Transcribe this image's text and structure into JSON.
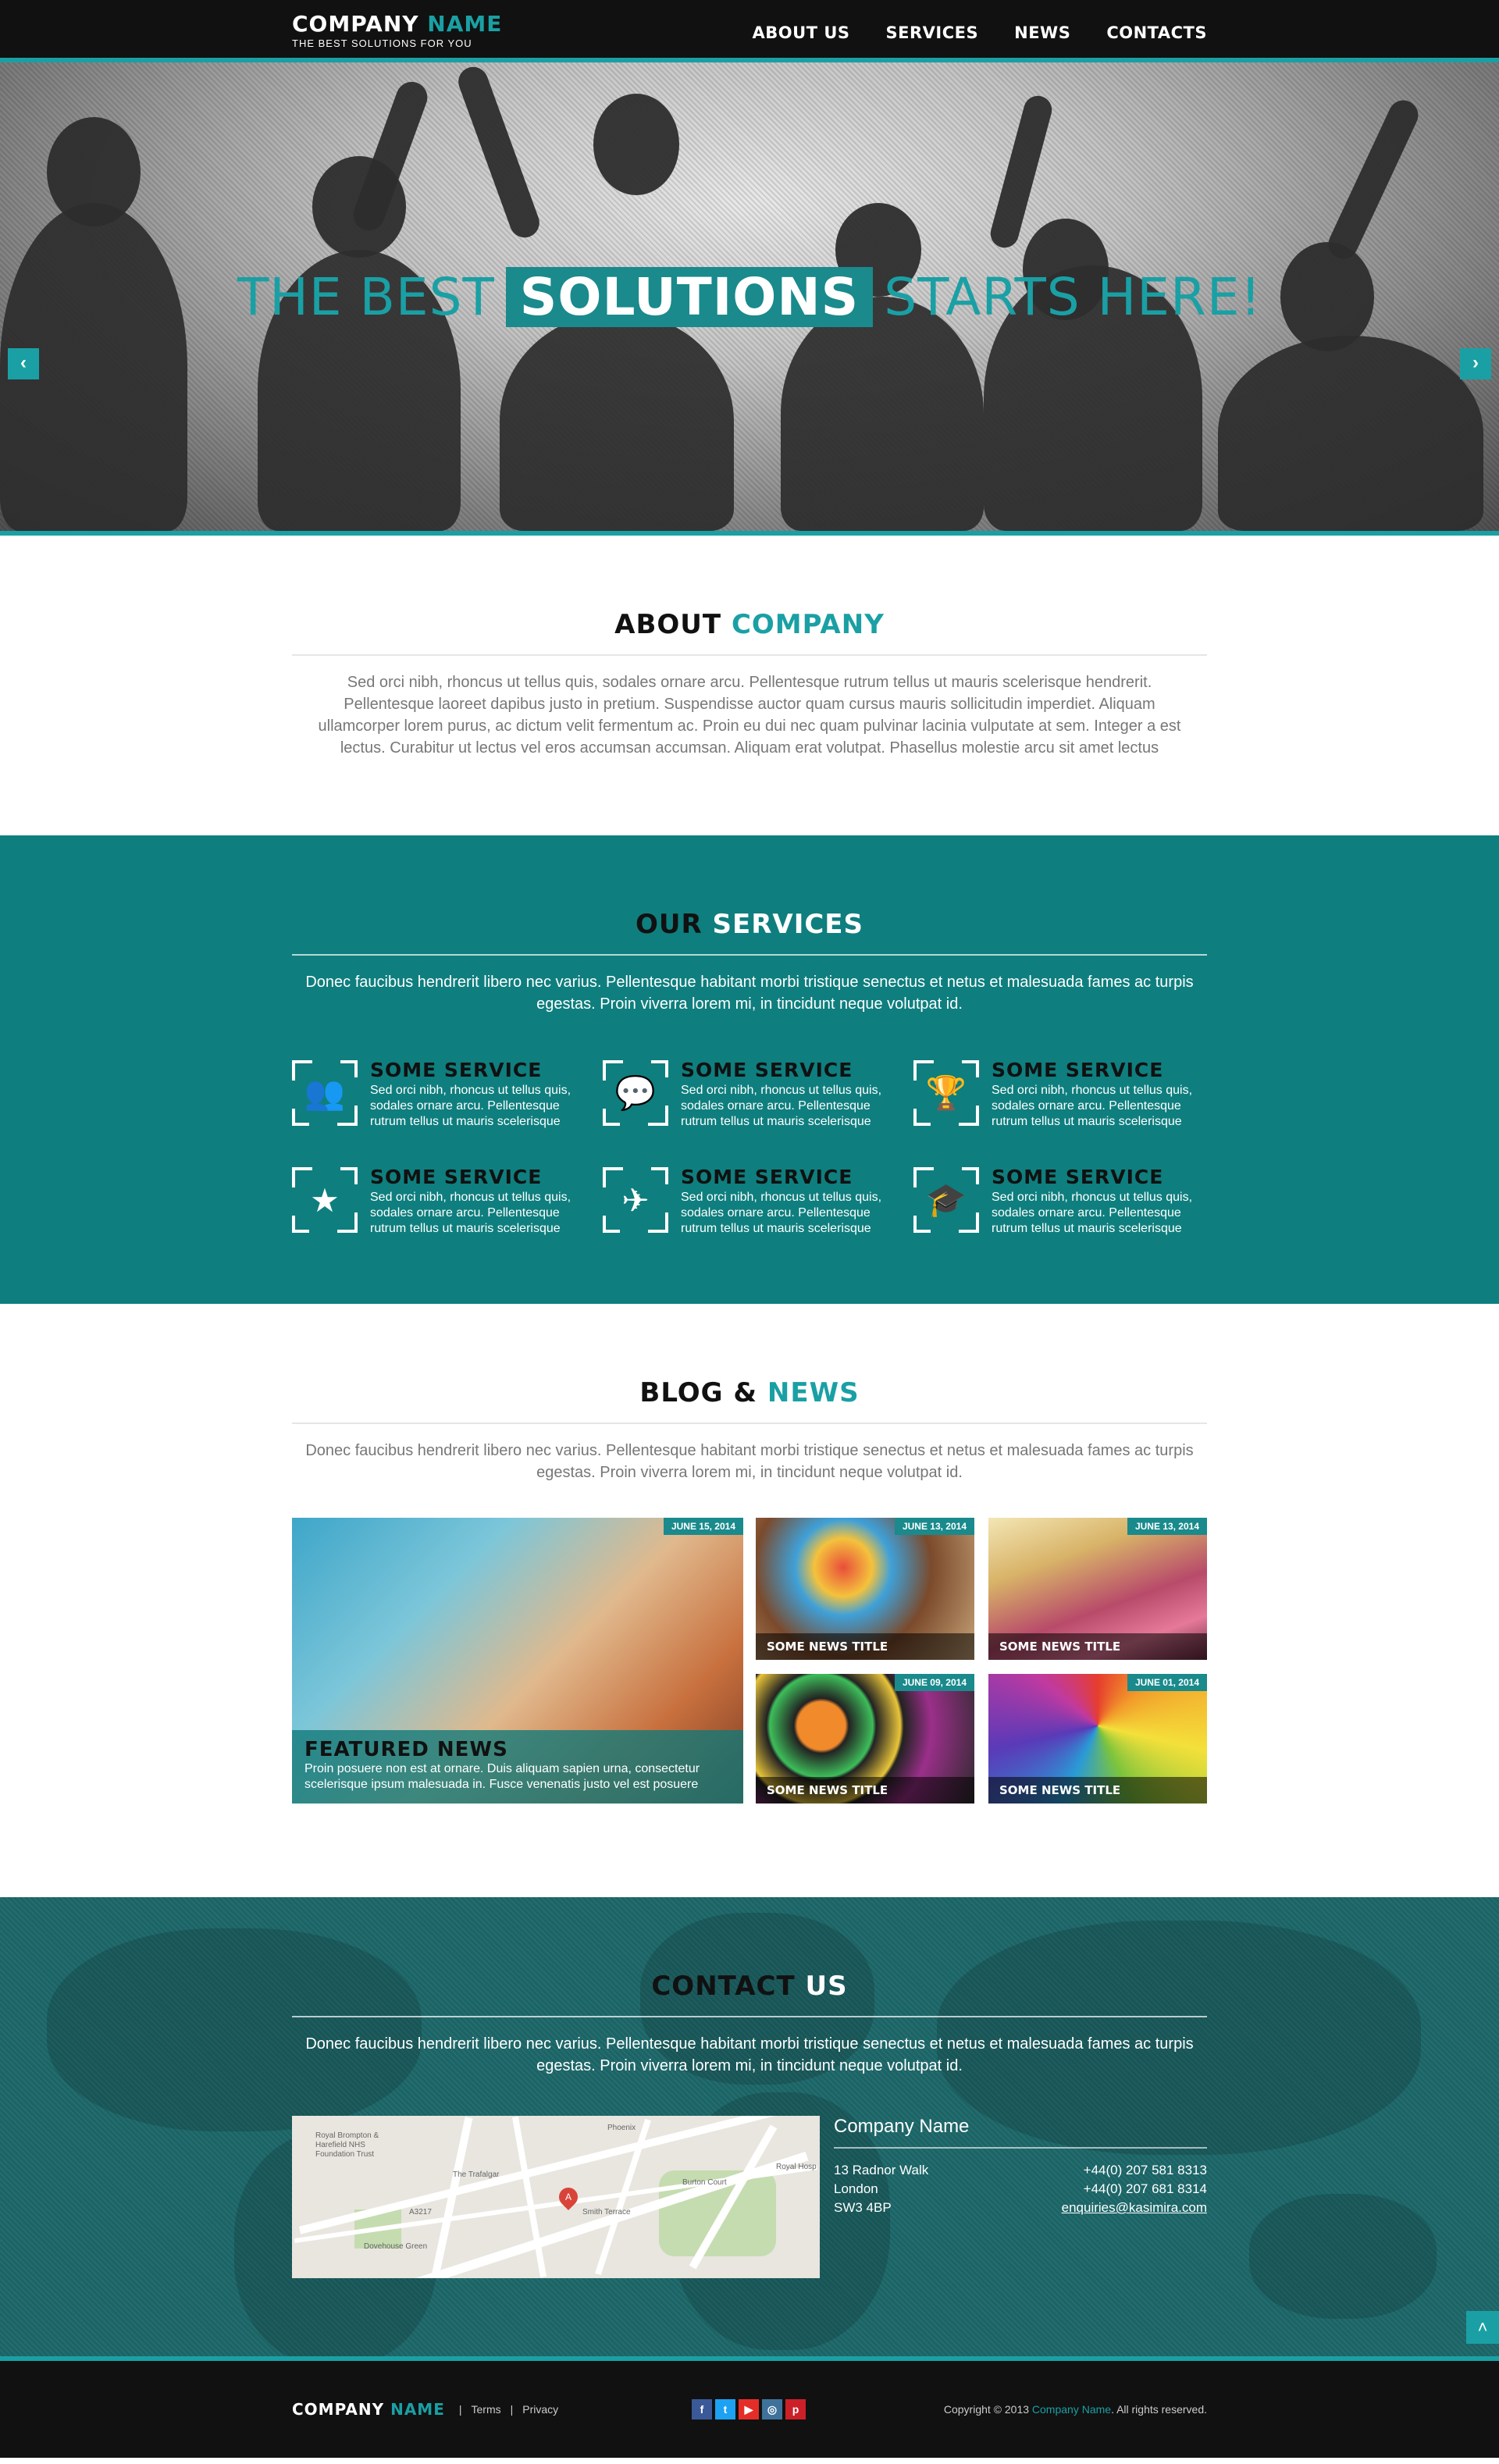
{
  "colors": {
    "accent": "#1aa0a4",
    "teal": "#0f7e7e",
    "dark": "#111111",
    "contact_bg": "#1b6466"
  },
  "header": {
    "logo_main": "COMPANY",
    "logo_accent": "NAME",
    "tagline": "THE BEST SOLUTIONS FOR YOU",
    "nav": [
      "ABOUT US",
      "SERVICES",
      "NEWS",
      "CONTACTS"
    ]
  },
  "hero": {
    "pre": "THE BEST",
    "highlight": "SOLUTIONS",
    "post": "STARTS HERE!",
    "prev_icon": "chevron-left-icon",
    "next_icon": "chevron-right-icon"
  },
  "about": {
    "title_dark": "ABOUT",
    "title_accent": "COMPANY",
    "text": "Sed orci nibh, rhoncus ut tellus quis, sodales ornare arcu. Pellentesque rutrum tellus ut mauris scelerisque hendrerit. Pellentesque laoreet dapibus justo in pretium. Suspendisse auctor quam cursus mauris sollicitudin imperdiet. Aliquam ullamcorper lorem purus, ac dictum velit fermentum ac. Proin eu dui nec quam pulvinar lacinia vulputate at sem. Integer a est lectus. Curabitur ut lectus vel eros accumsan accumsan. Aliquam erat volutpat. Phasellus molestie arcu sit amet lectus"
  },
  "services": {
    "title_dark": "OUR",
    "title_accent": "SERVICES",
    "text": "Donec faucibus hendrerit libero nec varius. Pellentesque habitant morbi tristique senectus et netus et malesuada fames ac turpis egestas. Proin viverra lorem mi, in tincidunt neque volutpat id.",
    "items": [
      {
        "title": "SOME SERVICE",
        "text": "Sed orci nibh, rhoncus ut tellus quis, sodales ornare arcu. Pellentesque rutrum tellus ut mauris scelerisque",
        "icon": "users-icon",
        "glyph": "👥"
      },
      {
        "title": "SOME SERVICE",
        "text": "Sed orci nibh, rhoncus ut tellus quis, sodales ornare arcu. Pellentesque rutrum tellus ut mauris scelerisque",
        "icon": "chat-icon",
        "glyph": "💬"
      },
      {
        "title": "SOME SERVICE",
        "text": "Sed orci nibh, rhoncus ut tellus quis, sodales ornare arcu. Pellentesque rutrum tellus ut mauris scelerisque",
        "icon": "trophy-icon",
        "glyph": "🏆"
      },
      {
        "title": "SOME SERVICE",
        "text": "Sed orci nibh, rhoncus ut tellus quis, sodales ornare arcu. Pellentesque rutrum tellus ut mauris scelerisque",
        "icon": "star-icon",
        "glyph": "★"
      },
      {
        "title": "SOME SERVICE",
        "text": "Sed orci nibh, rhoncus ut tellus quis, sodales ornare arcu. Pellentesque rutrum tellus ut mauris scelerisque",
        "icon": "airplane-icon",
        "glyph": "✈"
      },
      {
        "title": "SOME SERVICE",
        "text": "Sed orci nibh, rhoncus ut tellus quis, sodales ornare arcu. Pellentesque rutrum tellus ut mauris scelerisque",
        "icon": "graduation-cap-icon",
        "glyph": "🎓"
      }
    ]
  },
  "blog": {
    "title_dark": "BLOG &",
    "title_accent": "NEWS",
    "text": "Donec faucibus hendrerit libero nec varius. Pellentesque habitant morbi tristique senectus et netus et malesuada fames ac turpis egestas. Proin viverra lorem mi, in tincidunt neque volutpat id.",
    "featured": {
      "date": "JUNE 15, 2014",
      "title": "FEATURED NEWS",
      "text": "Proin posuere non est at ornare. Duis aliquam sapien urna, consectetur scelerisque ipsum malesuada in. Fusce venenatis justo vel est posuere"
    },
    "items": [
      {
        "date": "JUNE 13, 2014",
        "title": "SOME NEWS TITLE"
      },
      {
        "date": "JUNE 13, 2014",
        "title": "SOME NEWS TITLE"
      },
      {
        "date": "JUNE 09, 2014",
        "title": "SOME NEWS TITLE"
      },
      {
        "date": "JUNE 01, 2014",
        "title": "SOME NEWS TITLE"
      }
    ]
  },
  "contact": {
    "title_dark": "CONTACT",
    "title_accent": "US",
    "text": "Donec faucibus hendrerit libero nec varius. Pellentesque habitant morbi tristique senectus et netus et malesuada fames ac turpis egestas. Proin viverra lorem mi, in tincidunt neque volutpat id.",
    "company": "Company Name",
    "address": [
      "13 Radnor Walk",
      "London",
      "SW3 4BP"
    ],
    "phone1": "+44(0) 207 581 8313",
    "phone2": "+44(0) 207 681 8314",
    "email": "enquiries@kasimira.com",
    "map_pin": "A",
    "map_labels": [
      "Royal Brompton & Harefield NHS Foundation Trust",
      "The Trafalgar",
      "Dovehouse Green",
      "Burton Court",
      "Phoenix",
      "A3217",
      "Smith Terrace",
      "Royal Hosp"
    ]
  },
  "footer": {
    "logo_main": "COMPANY",
    "logo_accent": "NAME",
    "links": [
      "Terms",
      "Privacy"
    ],
    "social": [
      {
        "icon": "facebook-icon",
        "glyph": "f",
        "color": "#3b5998"
      },
      {
        "icon": "twitter-icon",
        "glyph": "t",
        "color": "#1da1f2"
      },
      {
        "icon": "youtube-icon",
        "glyph": "▶",
        "color": "#e52d27"
      },
      {
        "icon": "instagram-icon",
        "glyph": "◎",
        "color": "#3f729b"
      },
      {
        "icon": "pinterest-icon",
        "glyph": "p",
        "color": "#cb2027"
      }
    ],
    "copy_pre": "Copyright © 2013",
    "copy_accent": "Company Name",
    "copy_post": ". All rights reserved."
  }
}
